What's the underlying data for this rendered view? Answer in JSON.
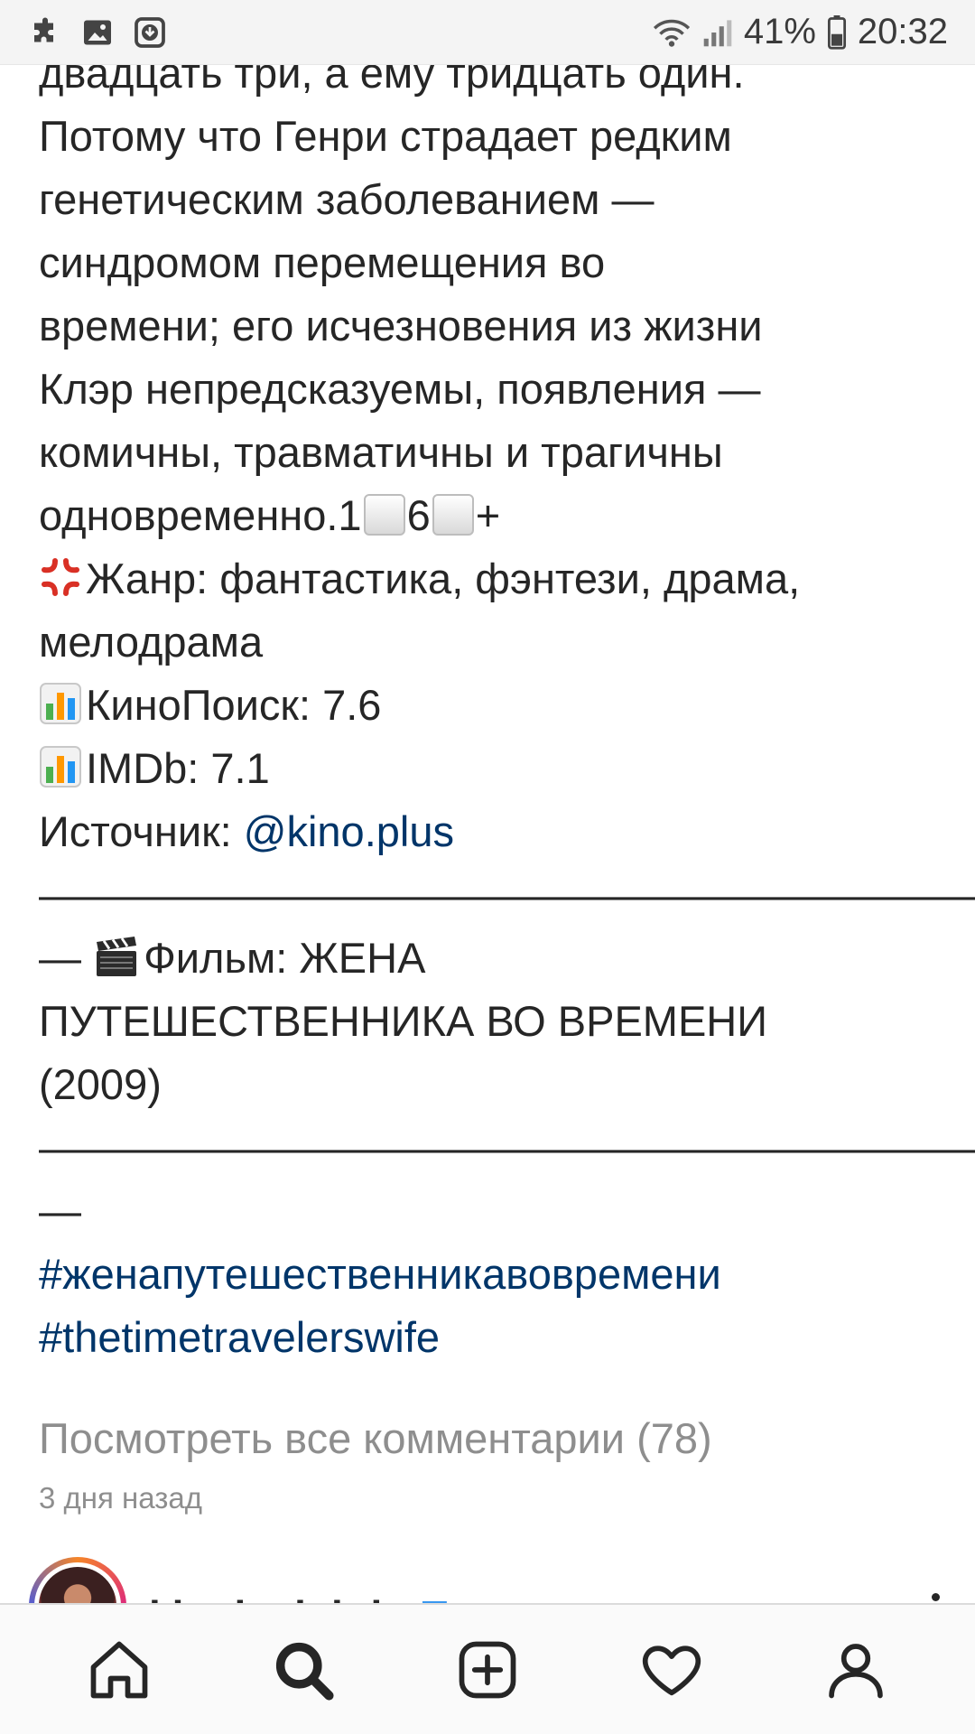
{
  "status_bar": {
    "battery": "41%",
    "time": "20:32",
    "icons_left": [
      "puzzle-icon",
      "gallery-icon",
      "download-icon"
    ],
    "icons_right": [
      "wifi-icon",
      "signal-icon",
      "battery-icon"
    ]
  },
  "caption": {
    "line1": "двадцать три, а ему тридцать один.",
    "line2": "Потому что Генри страдает редким",
    "line3": "генетическим заболеванием —",
    "line4": "синдромом перемещения во",
    "line5": "времени; его исчезновения из жизни",
    "line6": "Клэр непредсказуемы, появления —",
    "line7": "комичны, травматичны и трагичны",
    "line8_text": "одновременно.1",
    "line8_digit": "6",
    "line8_plus": "+",
    "genre_label": "Жанр: фантастика, фэнтези, драма,",
    "genre_cont": "мелодрама",
    "kinopoisk": "КиноПоиск: 7.6",
    "imdb": "IMDb: 7.1",
    "source_label": "Источник: ",
    "source_link": "@kino.plus",
    "divider1": "——————————————————————————",
    "film_prefix": "— ",
    "film_title1": "Фильм: ЖЕНА",
    "film_title2": "ПУТЕШЕСТВЕННИКА ВО ВРЕМЕНИ",
    "film_year": "(2009)",
    "divider2": "——————————————————————————",
    "divider3": "—",
    "hashtag1": "#женапутешественникавовремени",
    "hashtag2": "#thetimetravelerswife"
  },
  "comments": {
    "view_all": "Посмотреть все комментарии (78)",
    "timestamp": "3 дня назад"
  },
  "next_post": {
    "username": "kinokadr.hd",
    "separator": " • ",
    "follow": "Подписаться"
  },
  "bottom_nav": {
    "items": [
      "home-icon",
      "search-icon",
      "new-post-icon",
      "activity-icon",
      "profile-icon"
    ]
  }
}
